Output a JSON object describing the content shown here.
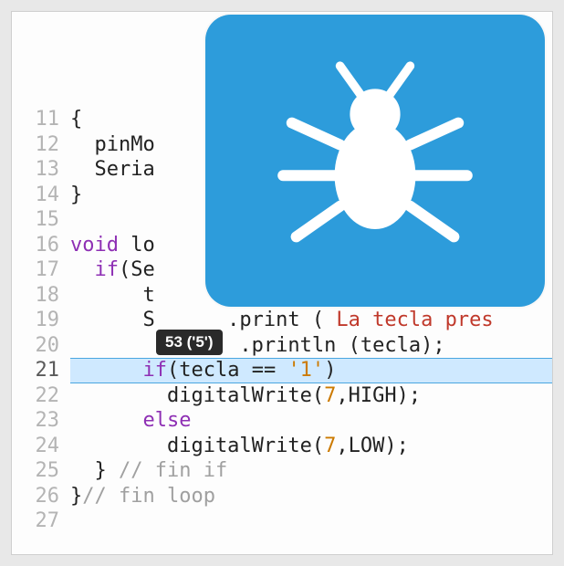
{
  "tooltip_text": "53 ('5')",
  "gutter": {
    "start": 11,
    "end": 27,
    "current": 21
  },
  "code_lines": [
    {
      "n": 11,
      "segs": [
        {
          "t": "{"
        }
      ]
    },
    {
      "n": 12,
      "segs": [
        {
          "t": "  pinMo"
        }
      ]
    },
    {
      "n": 13,
      "segs": [
        {
          "t": "  Seria"
        }
      ]
    },
    {
      "n": 14,
      "segs": [
        {
          "t": "}"
        }
      ]
    },
    {
      "n": 15,
      "segs": [
        {
          "t": ""
        }
      ]
    },
    {
      "n": 16,
      "segs": [
        {
          "t": "void",
          "cls": "kw"
        },
        {
          "t": " lo"
        }
      ]
    },
    {
      "n": 17,
      "segs": [
        {
          "t": "  "
        },
        {
          "t": "if",
          "cls": "kw"
        },
        {
          "t": "(Se"
        }
      ]
    },
    {
      "n": 18,
      "segs": [
        {
          "t": "      t"
        }
      ]
    },
    {
      "n": 19,
      "segs": [
        {
          "t": "      S      .print ( "
        },
        {
          "t": "La tecla pres",
          "cls": "str"
        }
      ]
    },
    {
      "n": 20,
      "segs": [
        {
          "t": "              .println (tecla);"
        }
      ]
    },
    {
      "n": 21,
      "segs": [
        {
          "t": "      "
        },
        {
          "t": "if",
          "cls": "kw"
        },
        {
          "t": "(tecla == "
        },
        {
          "t": "'1'",
          "cls": "char"
        },
        {
          "t": ")"
        }
      ]
    },
    {
      "n": 22,
      "segs": [
        {
          "t": "        digitalWrite("
        },
        {
          "t": "7",
          "cls": "num"
        },
        {
          "t": ",HIGH);"
        }
      ]
    },
    {
      "n": 23,
      "segs": [
        {
          "t": "      "
        },
        {
          "t": "else",
          "cls": "kw"
        }
      ]
    },
    {
      "n": 24,
      "segs": [
        {
          "t": "        digitalWrite("
        },
        {
          "t": "7",
          "cls": "num"
        },
        {
          "t": ",LOW);"
        }
      ]
    },
    {
      "n": 25,
      "segs": [
        {
          "t": "  } "
        },
        {
          "t": "// fin if",
          "cls": "cm"
        }
      ]
    },
    {
      "n": 26,
      "segs": [
        {
          "t": "}"
        },
        {
          "t": "// fin loop",
          "cls": "cm"
        }
      ]
    },
    {
      "n": 27,
      "segs": [
        {
          "t": ""
        }
      ]
    }
  ],
  "bug_icon": {
    "name": "bug-icon",
    "bg": "#2d9cdb",
    "fg": "#ffffff"
  }
}
